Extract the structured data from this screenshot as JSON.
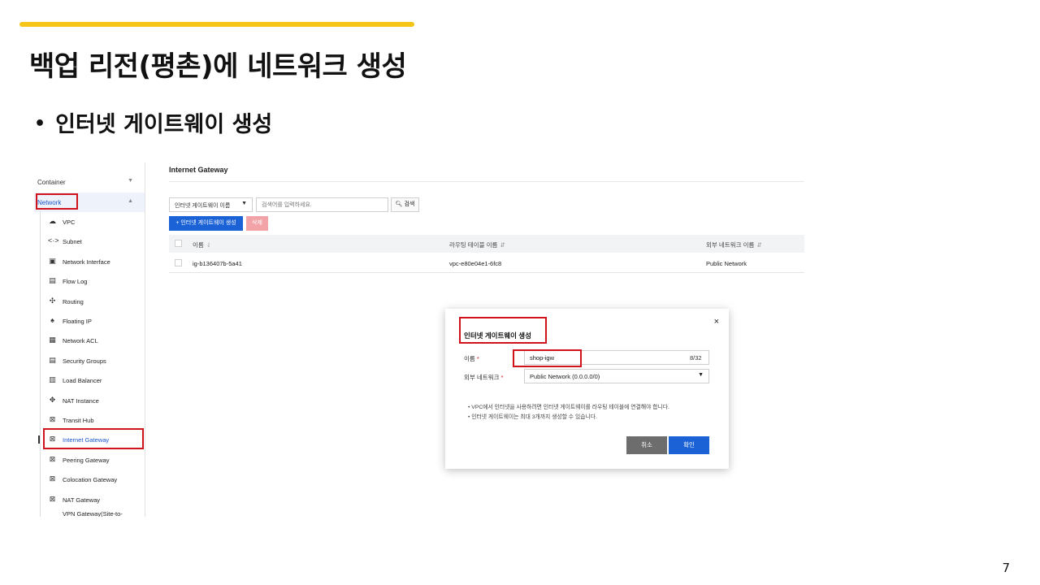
{
  "slide": {
    "title": "백업 리전(평촌)에 네트워크 생성",
    "bullet": "인터넷 게이트웨이 생성",
    "page_number": "7",
    "accent_color": "#f5c518"
  },
  "sidebar": {
    "categories": [
      {
        "label": "Container",
        "icon": "chevron-down-icon"
      },
      {
        "label": "Network",
        "icon": "chevron-up-icon"
      }
    ],
    "items": [
      {
        "label": "VPC",
        "icon": "cloud-icon"
      },
      {
        "label": "Subnet",
        "icon": "code-icon"
      },
      {
        "label": "Network Interface",
        "icon": "nic-icon"
      },
      {
        "label": "Flow Log",
        "icon": "log-icon"
      },
      {
        "label": "Routing",
        "icon": "routing-icon"
      },
      {
        "label": "Floating IP",
        "icon": "floating-ip-icon"
      },
      {
        "label": "Network ACL",
        "icon": "acl-icon"
      },
      {
        "label": "Security Groups",
        "icon": "security-icon"
      },
      {
        "label": "Load Balancer",
        "icon": "load-balancer-icon"
      },
      {
        "label": "NAT Instance",
        "icon": "nat-instance-icon"
      },
      {
        "label": "Transit Hub",
        "icon": "gateway-icon"
      },
      {
        "label": "Internet Gateway",
        "icon": "gateway-icon"
      },
      {
        "label": "Peering Gateway",
        "icon": "gateway-icon"
      },
      {
        "label": "Colocation Gateway",
        "icon": "gateway-icon"
      },
      {
        "label": "NAT Gateway",
        "icon": "gateway-icon"
      },
      {
        "label": "VPN Gateway(Site-to-",
        "icon": "gateway-icon"
      }
    ]
  },
  "main": {
    "title": "Internet Gateway",
    "filter_select": "인터넷 게이트웨이 이름",
    "search_placeholder": "검색어를 입력하세요.",
    "search_button": "검색",
    "create_button": "+ 인터넷 게이트웨이 생성",
    "delete_button": "삭제",
    "columns": [
      "이름",
      "라우팅 테이블 이름",
      "외부 네트워크 이름"
    ],
    "rows": [
      {
        "name": "ig-b136407b-5a41",
        "routing_table": "vpc-e80e04e1-6fc8",
        "external_network": "Public Network"
      }
    ]
  },
  "modal": {
    "title": "인터넷 게이트웨이 생성",
    "close": "×",
    "name_label": "이름",
    "name_value": "shop-igw",
    "name_count": "8/32",
    "network_label": "외부 네트워크",
    "network_value": "Public Network (0.0.0.0/0)",
    "notes": [
      "VPC에서 인터넷을 사용하려면 인터넷 게이트웨이를 라우팅 테이블에 연결해야 합니다.",
      "인터넷 게이트웨이는 최대 3개까지 생성할 수 있습니다."
    ],
    "cancel_button": "취소",
    "confirm_button": "확인"
  }
}
